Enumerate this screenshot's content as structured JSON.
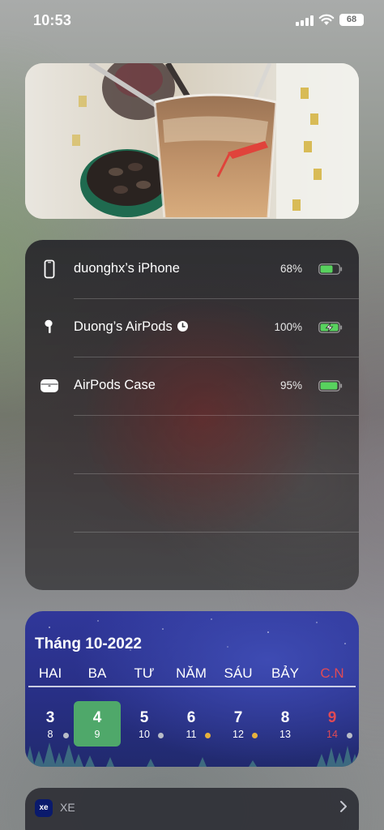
{
  "status_bar": {
    "time": "10:53",
    "battery_level": "68"
  },
  "photo_widget": {
    "subject": "iced coffee with straws"
  },
  "batteries_widget": {
    "devices": [
      {
        "name": "duonghx’s iPhone",
        "percent": "68%",
        "level": 0.68,
        "charging": false,
        "icon": "iphone-icon"
      },
      {
        "name": "Duong’s AirPods",
        "percent": "100%",
        "level": 1.0,
        "charging": true,
        "icon": "airpod-icon",
        "badge": "clock-icon"
      },
      {
        "name": "AirPods Case",
        "percent": "95%",
        "level": 0.95,
        "charging": false,
        "icon": "airpods-case-icon"
      }
    ],
    "battery_color": "#58d25e"
  },
  "calendar_widget": {
    "title": "Tháng 10-2022",
    "weekdays": [
      "HAI",
      "BA",
      "TƯ",
      "NĂM",
      "SÁU",
      "BẢY",
      "C.N"
    ],
    "days": [
      {
        "solar": "3",
        "lunar": "8",
        "dot": "gray"
      },
      {
        "solar": "4",
        "lunar": "9",
        "today": true
      },
      {
        "solar": "5",
        "lunar": "10",
        "dot": "gray"
      },
      {
        "solar": "6",
        "lunar": "11",
        "dot": "yellow"
      },
      {
        "solar": "7",
        "lunar": "12",
        "dot": "yellow"
      },
      {
        "solar": "8",
        "lunar": "13"
      },
      {
        "solar": "9",
        "lunar": "14",
        "dot": "gray",
        "sunday": true
      }
    ],
    "colors": {
      "today": "#4fa86a",
      "sunday": "#e04a55",
      "dot_gray": "#b9bdc8",
      "dot_yellow": "#e7b13c"
    }
  },
  "xe_widget": {
    "logo": "xe",
    "title": "XE"
  }
}
